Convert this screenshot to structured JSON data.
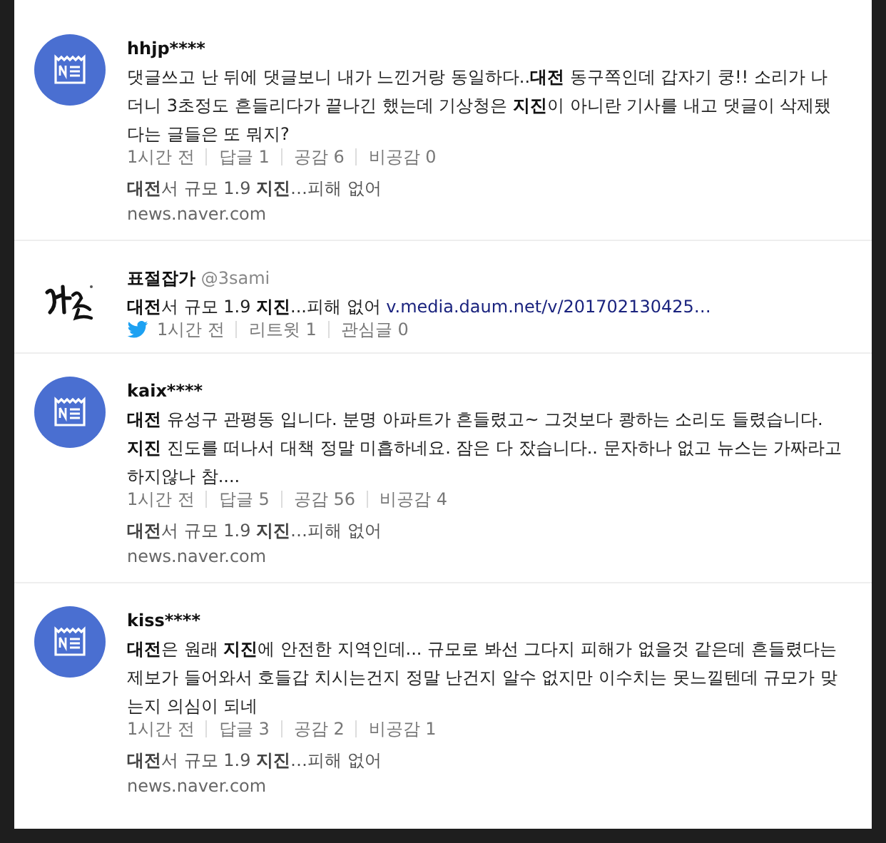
{
  "posts": [
    {
      "kind": "comment",
      "user": "hhjp****",
      "text": "댓글쓰고 난 뒤에 댓글보니 내가 느낀거랑 동일하다..**대전** 동구쪽인데 갑자기 쿵!! 소리가 나더니 3초정도 흔들리다가 끝나긴 했는데 기상청은 **지진**이 아니란 기사를 내고 댓글이 삭제됐다는 글들은 또 뭐지?",
      "meta": [
        "1시간 전",
        "답글 1",
        "공감 6",
        "비공감 0"
      ],
      "article": "**대전**서 규모 1.9 **지진**…피해 없어",
      "source": "news.naver.com"
    },
    {
      "kind": "tweet",
      "user": "표절잡가",
      "handle": "@3sami",
      "text": "**대전**서 규모 1.9 **지진**...피해 없어",
      "link": "v.media.daum.net/v/201702130425…",
      "meta": [
        "1시간 전",
        "리트윗 1",
        "관심글 0"
      ]
    },
    {
      "kind": "comment",
      "user": "kaix****",
      "text": "**대전** 유성구 관평동 입니다. 분명 아파트가 흔들렸고~ 그것보다 쾅하는 소리도 들렸습니다. **지진** 진도를 떠나서 대책 정말 미흡하네요. 잠은 다 잤습니다.. 문자하나 없고 뉴스는 가짜라고 하지않나 참....",
      "meta": [
        "1시간 전",
        "답글 5",
        "공감 56",
        "비공감 4"
      ],
      "article": "**대전**서 규모 1.9 **지진**…피해 없어",
      "source": "news.naver.com"
    },
    {
      "kind": "comment",
      "user": "kiss****",
      "text": "**대전**은 원래 **지진**에 안전한 지역인데... 규모로 봐선 그다지 피해가 없을것 같은데 흔들렸다는 제보가 들어와서 호들갑 치시는건지 정말 난건지 알수 없지만 이수치는 못느낄텐데 규모가 맞는지 의심이 되네",
      "meta": [
        "1시간 전",
        "답글 3",
        "공감 2",
        "비공감 1"
      ],
      "article": "**대전**서 규모 1.9 **지진**…피해 없어",
      "source": "news.naver.com"
    }
  ]
}
